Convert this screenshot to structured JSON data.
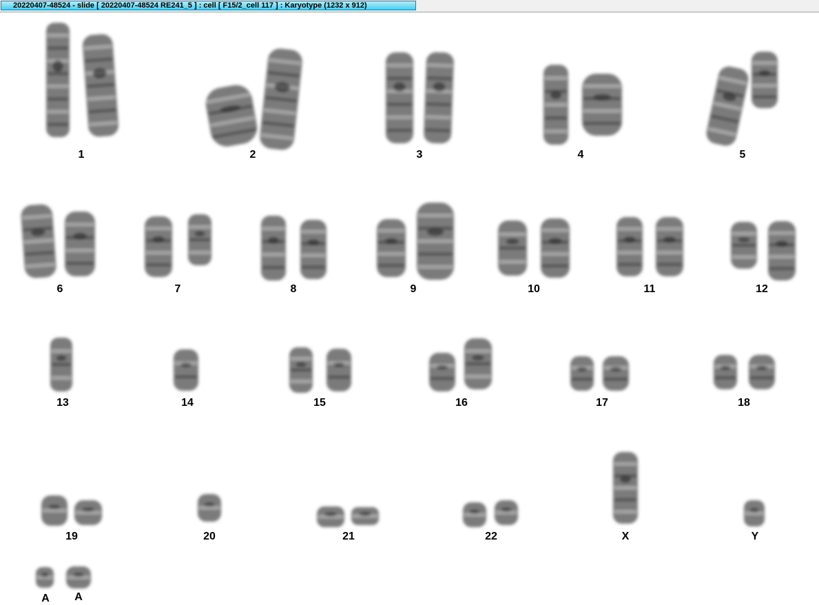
{
  "window": {
    "title": "20220407-48524 - slide [ 20220407-48524 RE241_5 ] : cell [ F15/2_cell 117 ] : Karyotype  (1232 x 912)"
  },
  "colors": {
    "chromosome": "#4a4a4a",
    "chromosome_dark": "#1e1e1e",
    "title_tab_start": "#b4eefc",
    "title_tab_end": "#3fd1f6"
  },
  "karyotype": {
    "pairs": [
      {
        "label": "1",
        "count": 2
      },
      {
        "label": "2",
        "count": 2
      },
      {
        "label": "3",
        "count": 2
      },
      {
        "label": "4",
        "count": 2
      },
      {
        "label": "5",
        "count": 2
      },
      {
        "label": "6",
        "count": 2
      },
      {
        "label": "7",
        "count": 2
      },
      {
        "label": "8",
        "count": 2
      },
      {
        "label": "9",
        "count": 2
      },
      {
        "label": "10",
        "count": 2
      },
      {
        "label": "11",
        "count": 2
      },
      {
        "label": "12",
        "count": 2
      },
      {
        "label": "13",
        "count": 1
      },
      {
        "label": "14",
        "count": 1
      },
      {
        "label": "15",
        "count": 2
      },
      {
        "label": "16",
        "count": 2
      },
      {
        "label": "17",
        "count": 2
      },
      {
        "label": "18",
        "count": 2
      },
      {
        "label": "19",
        "count": 2
      },
      {
        "label": "20",
        "count": 1
      },
      {
        "label": "21",
        "count": 2
      },
      {
        "label": "22",
        "count": 2
      },
      {
        "label": "X",
        "count": 1
      },
      {
        "label": "Y",
        "count": 1
      },
      {
        "label": "A",
        "count": 1
      },
      {
        "label": "A",
        "count": 1
      }
    ]
  }
}
